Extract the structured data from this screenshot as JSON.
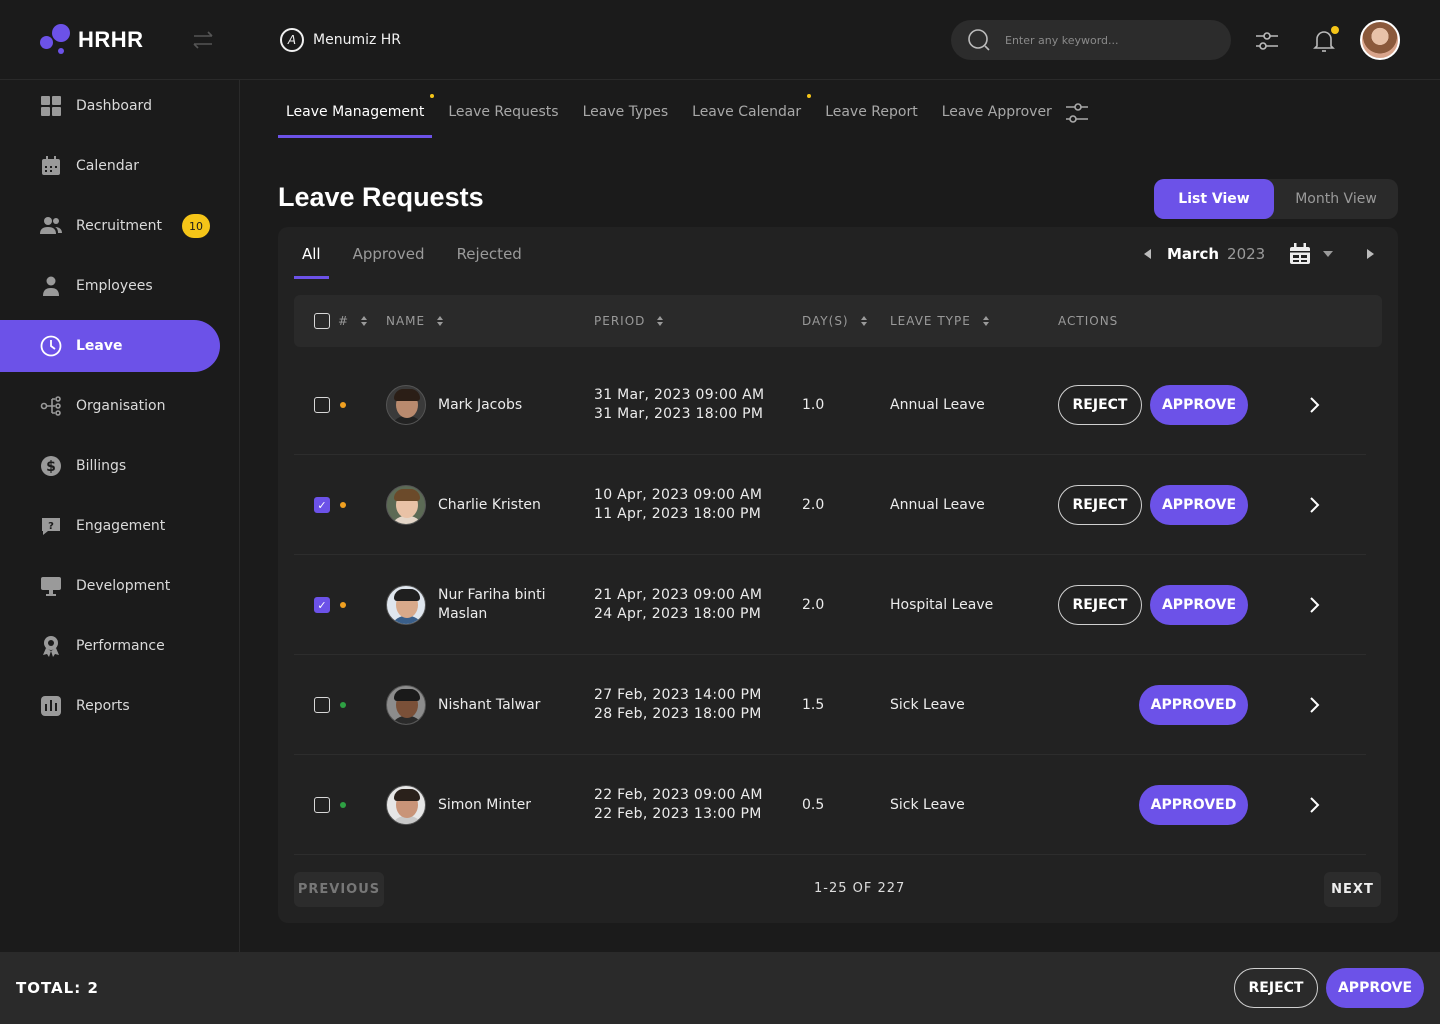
{
  "brand": {
    "name": "HRHR"
  },
  "header": {
    "company": "Menumiz HR",
    "company_icon": "A",
    "search_placeholder": "Enter any keyword..."
  },
  "sidebar": {
    "items": [
      {
        "label": "Dashboard",
        "icon": "grid-icon"
      },
      {
        "label": "Calendar",
        "icon": "calendar-icon"
      },
      {
        "label": "Recruitment",
        "icon": "users-icon",
        "badge": "10"
      },
      {
        "label": "Employees",
        "icon": "person-icon"
      },
      {
        "label": "Leave",
        "icon": "clock-icon",
        "active": true
      },
      {
        "label": "Organisation",
        "icon": "org-icon"
      },
      {
        "label": "Billings",
        "icon": "dollar-icon"
      },
      {
        "label": "Engagement",
        "icon": "chat-icon"
      },
      {
        "label": "Development",
        "icon": "monitor-icon"
      },
      {
        "label": "Performance",
        "icon": "award-icon"
      },
      {
        "label": "Reports",
        "icon": "report-icon"
      }
    ]
  },
  "subtabs": [
    {
      "label": "Leave Management",
      "active": true,
      "dot": true
    },
    {
      "label": "Leave Requests"
    },
    {
      "label": "Leave Types"
    },
    {
      "label": "Leave Calendar",
      "dot": true
    },
    {
      "label": "Leave Report"
    },
    {
      "label": "Leave Approver"
    }
  ],
  "main": {
    "title": "Leave Requests",
    "views": {
      "list": "List View",
      "month": "Month View"
    },
    "filters": [
      "All",
      "Approved",
      "Rejected"
    ],
    "month": "March",
    "year": "2023"
  },
  "table": {
    "headers": {
      "num": "#",
      "name": "NAME",
      "period": "PERIOD",
      "days": "DAY(S)",
      "type": "LEAVE TYPE",
      "actions": "ACTIONS"
    },
    "rows": [
      {
        "name": "Mark Jacobs",
        "start": "31 Mar, 2023 09:00 AM",
        "end": "31 Mar, 2023 18:00 PM",
        "days": "1.0",
        "type": "Annual Leave",
        "checked": false,
        "status": "pending"
      },
      {
        "name": "Charlie Kristen",
        "start": "10 Apr, 2023 09:00 AM",
        "end": "11 Apr, 2023 18:00 PM",
        "days": "2.0",
        "type": "Annual Leave",
        "checked": true,
        "status": "pending"
      },
      {
        "name": "Nur Fariha binti Maslan",
        "start": "21 Apr, 2023 09:00 AM",
        "end": "24 Apr, 2023 18:00 PM",
        "days": "2.0",
        "type": "Hospital Leave",
        "checked": true,
        "status": "pending"
      },
      {
        "name": "Nishant Talwar",
        "start": "27 Feb, 2023 14:00 PM",
        "end": "28 Feb, 2023 18:00 PM",
        "days": "1.5",
        "type": "Sick Leave",
        "checked": false,
        "status": "approved"
      },
      {
        "name": "Simon Minter",
        "start": "22 Feb, 2023 09:00 AM",
        "end": "22 Feb, 2023 13:00 PM",
        "days": "0.5",
        "type": "Sick Leave",
        "checked": false,
        "status": "approved"
      }
    ],
    "labels": {
      "reject": "REJECT",
      "approve": "APPROVE",
      "approved": "APPROVED"
    }
  },
  "pager": {
    "prev": "PREVIOUS",
    "info": "1-25 OF 227",
    "next": "NEXT"
  },
  "footer": {
    "total": "TOTAL: 2",
    "reject": "REJECT",
    "approve": "APPROVE"
  },
  "colors": {
    "accent": "#6c52e8",
    "pending": "#f0a020",
    "approved": "#2ea043",
    "badge": "#f5c518"
  }
}
